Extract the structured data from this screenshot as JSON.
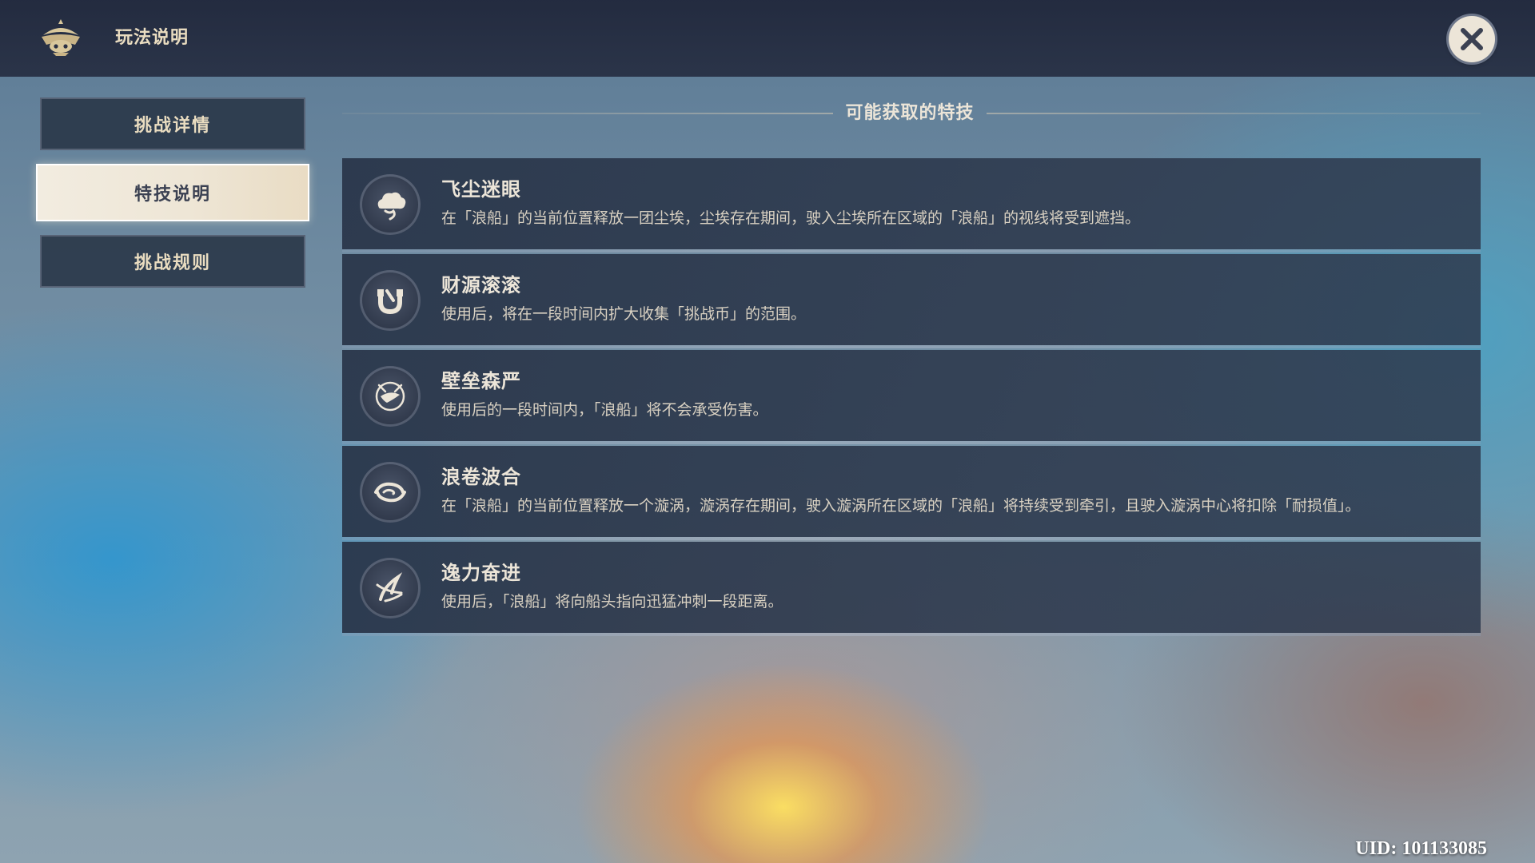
{
  "header": {
    "title": "玩法说明",
    "emblem_icon": "festival-emblem-icon",
    "close_icon": "close-icon"
  },
  "tabs": [
    {
      "label": "挑战详情",
      "active": false
    },
    {
      "label": "特技说明",
      "active": true
    },
    {
      "label": "挑战规则",
      "active": false
    }
  ],
  "main": {
    "section_title": "可能获取的特技",
    "skills": [
      {
        "name": "飞尘迷眼",
        "icon": "dust-cloud-icon",
        "description": "在「浪船」的当前位置释放一团尘埃，尘埃存在期间，驶入尘埃所在区域的「浪船」的视线将受到遮挡。"
      },
      {
        "name": "财源滚滚",
        "icon": "magnet-icon",
        "description": "使用后，将在一段时间内扩大收集「挑战币」的范围。"
      },
      {
        "name": "壁垒森严",
        "icon": "shield-barrier-icon",
        "description": "使用后的一段时间内，「浪船」将不会承受伤害。"
      },
      {
        "name": "浪卷波合",
        "icon": "whirlpool-icon",
        "description": "在「浪船」的当前位置释放一个漩涡，漩涡存在期间，驶入漩涡所在区域的「浪船」将持续受到牵引，且驶入漩涡中心将扣除「耐损值」。"
      },
      {
        "name": "逸力奋进",
        "icon": "dash-boost-icon",
        "description": "使用后，「浪船」将向船头指向迅猛冲刺一段距离。"
      }
    ]
  },
  "footer": {
    "uid": "UID: 101133085"
  },
  "colors": {
    "header_bg": "#21283c",
    "text_primary": "#ece5d8",
    "tab_active_bg": "#f2ece0",
    "tab_active_text": "#3b4152",
    "card_bg": "#28344a"
  }
}
